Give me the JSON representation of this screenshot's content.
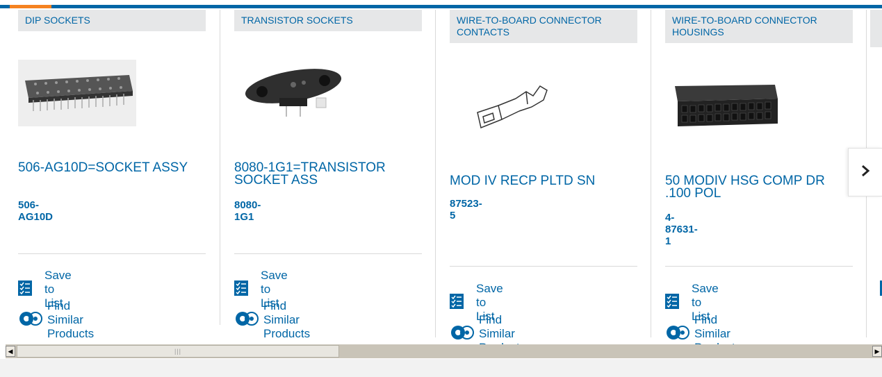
{
  "cards": [
    {
      "category": "DIP SOCKETS",
      "title": "506-AG10D=SOCKET ASSY",
      "part_number": "506-AG10D",
      "save_label": "Save to List",
      "similar_label": "Find Similar Products"
    },
    {
      "category": "TRANSISTOR SOCKETS",
      "title": "8080-1G1=TRANSISTOR SOCKET ASS",
      "part_number": "8080-1G1",
      "save_label": "Save to List",
      "similar_label": "Find Similar Products"
    },
    {
      "category": "WIRE-TO-BOARD CONNECTOR CONTACTS",
      "title": "MOD IV RECP PLTD SN",
      "part_number": "87523-5",
      "save_label": "Save to List",
      "similar_label": "Find Similar Products"
    },
    {
      "category": "WIRE-TO-BOARD CONNECTOR HOUSINGS",
      "title": "50 MODIV HSG COMP DR .100 POL",
      "part_number": "4-87631-1",
      "save_label": "Save to List",
      "similar_label": "Find Similar Products"
    }
  ],
  "icons": {
    "save": "checklist-icon",
    "similar": "gears-icon",
    "next": "chevron-right-icon"
  },
  "colors": {
    "brand_blue": "#0066a6",
    "accent_orange": "#f58220",
    "category_bg": "#e6e7e8"
  }
}
